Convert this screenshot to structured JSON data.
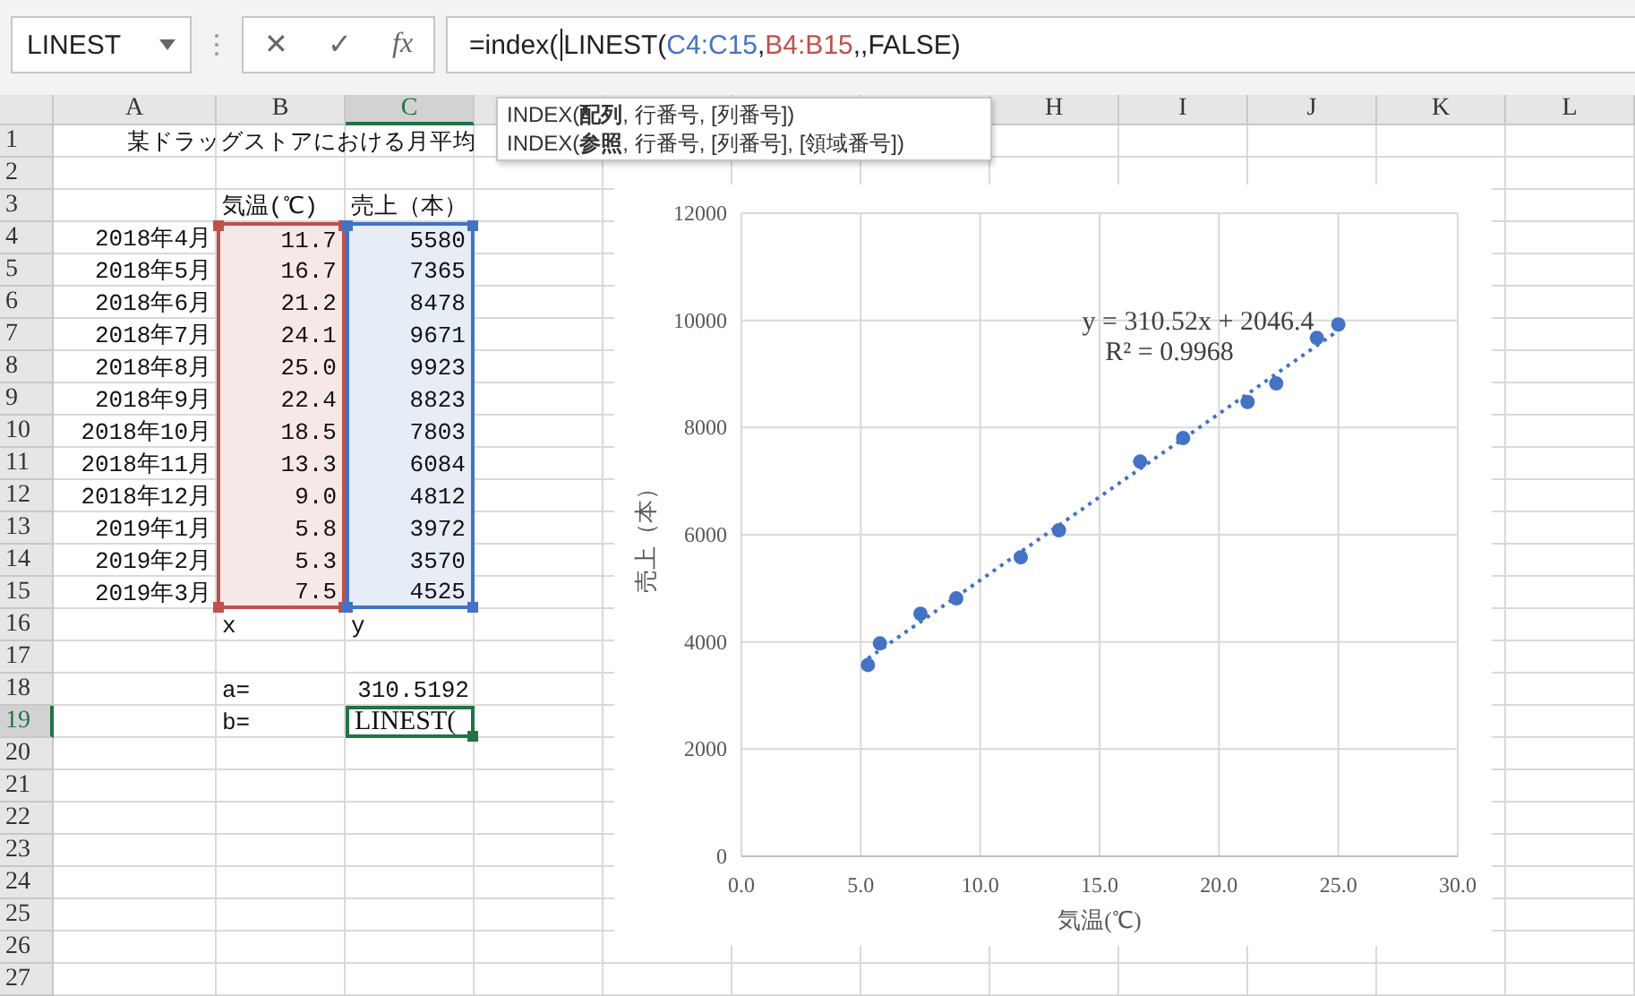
{
  "name_box": {
    "value": "LINEST"
  },
  "formula_bar": {
    "buttons": [
      "✕",
      "✓",
      "fx"
    ],
    "segments": [
      {
        "text": "=index("
      },
      {
        "text": "LINEST("
      },
      {
        "text": "C4:C15",
        "color": "#4472c4"
      },
      {
        "text": ","
      },
      {
        "text": "B4:B15",
        "color": "#c0504d"
      },
      {
        "text": ",,FALSE)"
      }
    ]
  },
  "tooltip": {
    "lines": [
      "INDEX(**配列**, 行番号, [列番号])",
      "INDEX(**参照**, 行番号, [列番号], [領域番号])"
    ]
  },
  "sheet": {
    "columns": [
      {
        "label": "A",
        "selected": false
      },
      {
        "label": "B",
        "selected": false
      },
      {
        "label": "C",
        "selected": true
      },
      {
        "selected": false
      },
      {
        "selected": false
      },
      {
        "selected": false
      },
      {
        "selected": false
      },
      {
        "label": "H",
        "selected": false
      },
      {
        "label": "I",
        "selected": false
      },
      {
        "label": "J",
        "selected": false
      },
      {
        "label": "K",
        "selected": false
      },
      {
        "label": "L",
        "selected": false
      }
    ],
    "rows": [
      {
        "label": "1",
        "selected": false,
        "cells": [
          {
            "text": "某ドラッグストアにおける月平均",
            "kind": "title"
          }
        ]
      },
      {
        "label": "2",
        "selected": false
      },
      {
        "label": "3",
        "selected": false,
        "cells": [
          null,
          {
            "text": "気温(℃)",
            "kind": "text"
          },
          {
            "text": "売上（本）",
            "kind": "text"
          }
        ]
      },
      {
        "label": "4",
        "selected": false,
        "cells": [
          {
            "text": "2018年4月",
            "kind": "date"
          },
          {
            "text": "11.7",
            "kind": "number",
            "color": "#c0504d"
          },
          {
            "text": "5580",
            "kind": "number",
            "color": "#4472c4"
          }
        ]
      },
      {
        "label": "5",
        "selected": false,
        "cells": [
          {
            "text": "2018年5月",
            "kind": "date"
          },
          {
            "text": "16.7",
            "kind": "number",
            "color": "#c0504d"
          },
          {
            "text": "7365",
            "kind": "number",
            "color": "#4472c4"
          }
        ]
      },
      {
        "label": "6",
        "selected": false,
        "cells": [
          {
            "text": "2018年6月",
            "kind": "date"
          },
          {
            "text": "21.2",
            "kind": "number",
            "color": "#c0504d"
          },
          {
            "text": "8478",
            "kind": "number",
            "color": "#4472c4"
          }
        ]
      },
      {
        "label": "7",
        "selected": false,
        "cells": [
          {
            "text": "2018年7月",
            "kind": "date"
          },
          {
            "text": "24.1",
            "kind": "number",
            "color": "#c0504d"
          },
          {
            "text": "9671",
            "kind": "number",
            "color": "#4472c4"
          }
        ]
      },
      {
        "label": "8",
        "selected": false,
        "cells": [
          {
            "text": "2018年8月",
            "kind": "date"
          },
          {
            "text": "25.0",
            "kind": "number",
            "color": "#c0504d"
          },
          {
            "text": "9923",
            "kind": "number",
            "color": "#4472c4"
          }
        ]
      },
      {
        "label": "9",
        "selected": false,
        "cells": [
          {
            "text": "2018年9月",
            "kind": "date"
          },
          {
            "text": "22.4",
            "kind": "number",
            "color": "#c0504d"
          },
          {
            "text": "8823",
            "kind": "number",
            "color": "#4472c4"
          }
        ]
      },
      {
        "label": "10",
        "selected": false,
        "cells": [
          {
            "text": "2018年10月",
            "kind": "date"
          },
          {
            "text": "18.5",
            "kind": "number",
            "color": "#c0504d"
          },
          {
            "text": "7803",
            "kind": "number",
            "color": "#4472c4"
          }
        ]
      },
      {
        "label": "11",
        "selected": false,
        "cells": [
          {
            "text": "2018年11月",
            "kind": "date"
          },
          {
            "text": "13.3",
            "kind": "number",
            "color": "#c0504d"
          },
          {
            "text": "6084",
            "kind": "number",
            "color": "#4472c4"
          }
        ]
      },
      {
        "label": "12",
        "selected": false,
        "cells": [
          {
            "text": "2018年12月",
            "kind": "date"
          },
          {
            "text": "9.0",
            "kind": "number",
            "color": "#c0504d"
          },
          {
            "text": "4812",
            "kind": "number",
            "color": "#4472c4"
          }
        ]
      },
      {
        "label": "13",
        "selected": false,
        "cells": [
          {
            "text": "2019年1月",
            "kind": "date"
          },
          {
            "text": "5.8",
            "kind": "number",
            "color": "#c0504d"
          },
          {
            "text": "3972",
            "kind": "number",
            "color": "#4472c4"
          }
        ]
      },
      {
        "label": "14",
        "selected": false,
        "cells": [
          {
            "text": "2019年2月",
            "kind": "date"
          },
          {
            "text": "5.3",
            "kind": "number",
            "color": "#c0504d"
          },
          {
            "text": "3570",
            "kind": "number",
            "color": "#4472c4"
          }
        ]
      },
      {
        "label": "15",
        "selected": false,
        "cells": [
          {
            "text": "2019年3月",
            "kind": "date"
          },
          {
            "text": "7.5",
            "kind": "number",
            "color": "#c0504d"
          },
          {
            "text": "4525",
            "kind": "number",
            "color": "#4472c4"
          }
        ]
      },
      {
        "label": "16",
        "selected": false,
        "cells": [
          null,
          {
            "text": "x",
            "kind": "text"
          },
          {
            "text": "y",
            "kind": "text"
          }
        ]
      },
      {
        "label": "17",
        "selected": false
      },
      {
        "label": "18",
        "selected": false,
        "cells": [
          null,
          {
            "text": "a=",
            "kind": "text"
          },
          {
            "text": "310.5192",
            "kind": "number"
          }
        ]
      },
      {
        "label": "19",
        "selected": true,
        "cells": [
          null,
          {
            "text": "b=",
            "kind": "text"
          },
          {
            "text": "LINEST(",
            "kind": "edit",
            "active": true
          }
        ]
      },
      {
        "label": "20",
        "selected": false
      },
      {
        "label": "21",
        "selected": false
      },
      {
        "label": "22",
        "selected": false
      },
      {
        "label": "23",
        "selected": false
      },
      {
        "label": "24",
        "selected": false
      },
      {
        "label": "25",
        "selected": false
      },
      {
        "label": "26",
        "selected": false
      },
      {
        "label": "27",
        "selected": false
      }
    ]
  },
  "chart": {
    "chart_data": {
      "type": "scatter",
      "grid": true,
      "xlabel": "気温(℃)",
      "ylabel": "売上（本）",
      "x": [
        11.7,
        16.7,
        21.2,
        24.1,
        25.0,
        22.4,
        18.5,
        13.3,
        9.0,
        5.8,
        5.3,
        7.5
      ],
      "series": [
        {
          "color": "#4472c4",
          "values": [
            5580,
            7365,
            8478,
            9671,
            9923,
            8823,
            7803,
            6084,
            4812,
            3972,
            3570,
            4525
          ]
        }
      ],
      "xlim": [
        0,
        30
      ],
      "ylim": [
        0,
        12000
      ],
      "xticks": [
        {
          "value": 0,
          "label": "0.0"
        },
        {
          "value": 5,
          "label": "5.0"
        },
        {
          "value": 10,
          "label": "10.0"
        },
        {
          "value": 15,
          "label": "15.0"
        },
        {
          "value": 20,
          "label": "20.0"
        },
        {
          "value": 25,
          "label": "25.0"
        },
        {
          "value": 30,
          "label": "30.0"
        }
      ],
      "yticks": [
        0,
        2000,
        4000,
        6000,
        8000,
        10000,
        12000
      ],
      "annotations": [
        "y = 310.52x + 2046.4",
        "R² = 0.9968"
      ]
    }
  }
}
